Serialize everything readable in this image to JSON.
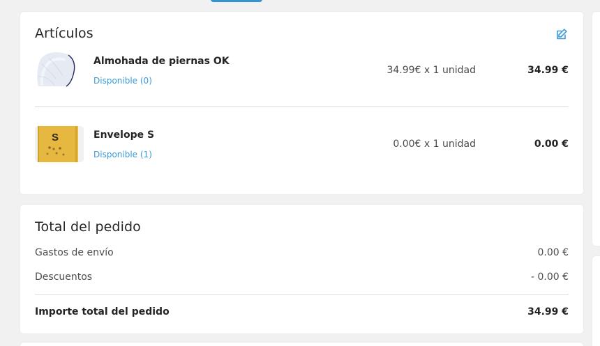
{
  "articles": {
    "title": "Artículos",
    "edit_icon": "edit-icon",
    "items": [
      {
        "name": "Almohada de piernas OK",
        "availability": "Disponible (0)",
        "qty_text": "34.99€ x 1 unidad",
        "price": "34.99 €",
        "thumb_icon": "pillow-image"
      },
      {
        "name": "Envelope S",
        "availability": "Disponible (1)",
        "qty_text": "0.00€ x 1 unidad",
        "price": "0.00 €",
        "thumb_icon": "envelope-image",
        "thumb_label": "S"
      }
    ]
  },
  "summary": {
    "title": "Total del pedido",
    "shipping_label": "Gastos de envío",
    "shipping_value": "0.00 €",
    "discount_label": "Descuentos",
    "discount_value": "- 0.00 €",
    "total_label": "Importe total del pedido",
    "total_value": "34.99 €"
  },
  "colors": {
    "accent": "#3a9ad9",
    "background": "#f1f1f1",
    "card": "#ffffff",
    "text": "#262626"
  }
}
